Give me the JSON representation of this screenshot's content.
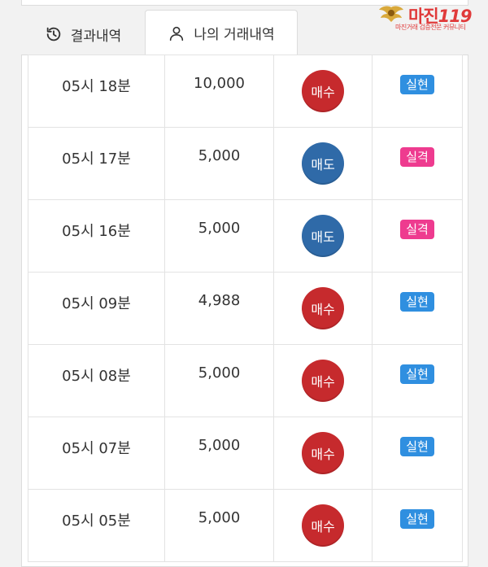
{
  "logo": {
    "text": "마진",
    "suffix": "119",
    "subtitle": "마진거래 검증전문 커뮤니티",
    "color": "#e03a3a"
  },
  "tabs": [
    {
      "label": "결과내역",
      "icon": "history-icon",
      "active": false
    },
    {
      "label": "나의 거래내역",
      "icon": "user-icon",
      "active": true
    }
  ],
  "trades": [
    {
      "time": "05시 18분",
      "amount": "10,000",
      "type": "매수",
      "result": "실현"
    },
    {
      "time": "05시 17분",
      "amount": "5,000",
      "type": "매도",
      "result": "실격"
    },
    {
      "time": "05시 16분",
      "amount": "5,000",
      "type": "매도",
      "result": "실격"
    },
    {
      "time": "05시 09분",
      "amount": "4,988",
      "type": "매수",
      "result": "실현"
    },
    {
      "time": "05시 08분",
      "amount": "5,000",
      "type": "매수",
      "result": "실현"
    },
    {
      "time": "05시 07분",
      "amount": "5,000",
      "type": "매수",
      "result": "실현"
    },
    {
      "time": "05시 05분",
      "amount": "5,000",
      "type": "매수",
      "result": "실현"
    }
  ],
  "colors": {
    "buy": "#c62a2d",
    "sell": "#2f6aa8",
    "realized": "#2f8fe0",
    "failed": "#ee3b8f"
  }
}
